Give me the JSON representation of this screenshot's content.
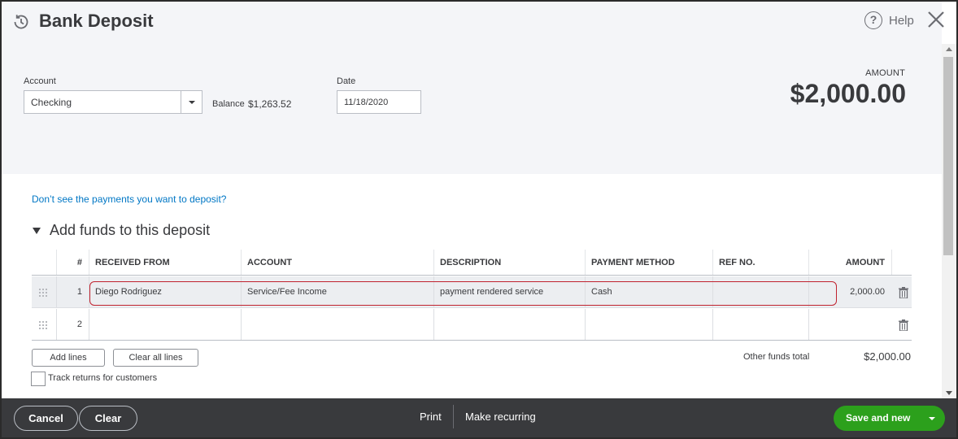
{
  "window": {
    "title": "Bank Deposit",
    "help_label": "Help"
  },
  "form": {
    "account_label": "Account",
    "account_value": "Checking",
    "balance_label": "Balance",
    "balance_value": "$1,263.52",
    "date_label": "Date",
    "date_value": "11/18/2020",
    "amount_label": "AMOUNT",
    "amount_total": "$2,000.00"
  },
  "payments_link": "Don’t see the payments you want to deposit?",
  "section": {
    "title": "Add funds to this deposit"
  },
  "table": {
    "columns": [
      "#",
      "RECEIVED FROM",
      "ACCOUNT",
      "DESCRIPTION",
      "PAYMENT METHOD",
      "REF NO.",
      "AMOUNT"
    ],
    "rows": [
      {
        "num": "1",
        "received_from": "Diego Rodriguez",
        "account": "Service/Fee Income",
        "description": "payment rendered service",
        "payment_method": "Cash",
        "ref_no": "",
        "amount": "2,000.00"
      },
      {
        "num": "2",
        "received_from": "",
        "account": "",
        "description": "",
        "payment_method": "",
        "ref_no": "",
        "amount": ""
      }
    ]
  },
  "actions": {
    "add_lines": "Add lines",
    "clear_all_lines": "Clear all lines",
    "track_returns": "Track returns for customers",
    "other_funds_label": "Other funds total",
    "other_funds_value": "$2,000.00"
  },
  "footer": {
    "cancel": "Cancel",
    "clear": "Clear",
    "print": "Print",
    "make_recurring": "Make recurring",
    "save_and_new": "Save and new"
  },
  "colors": {
    "link": "#0077c5",
    "primary_green": "#2ca01c",
    "footer_bg": "#393a3d",
    "highlight_red": "#c0222e"
  }
}
